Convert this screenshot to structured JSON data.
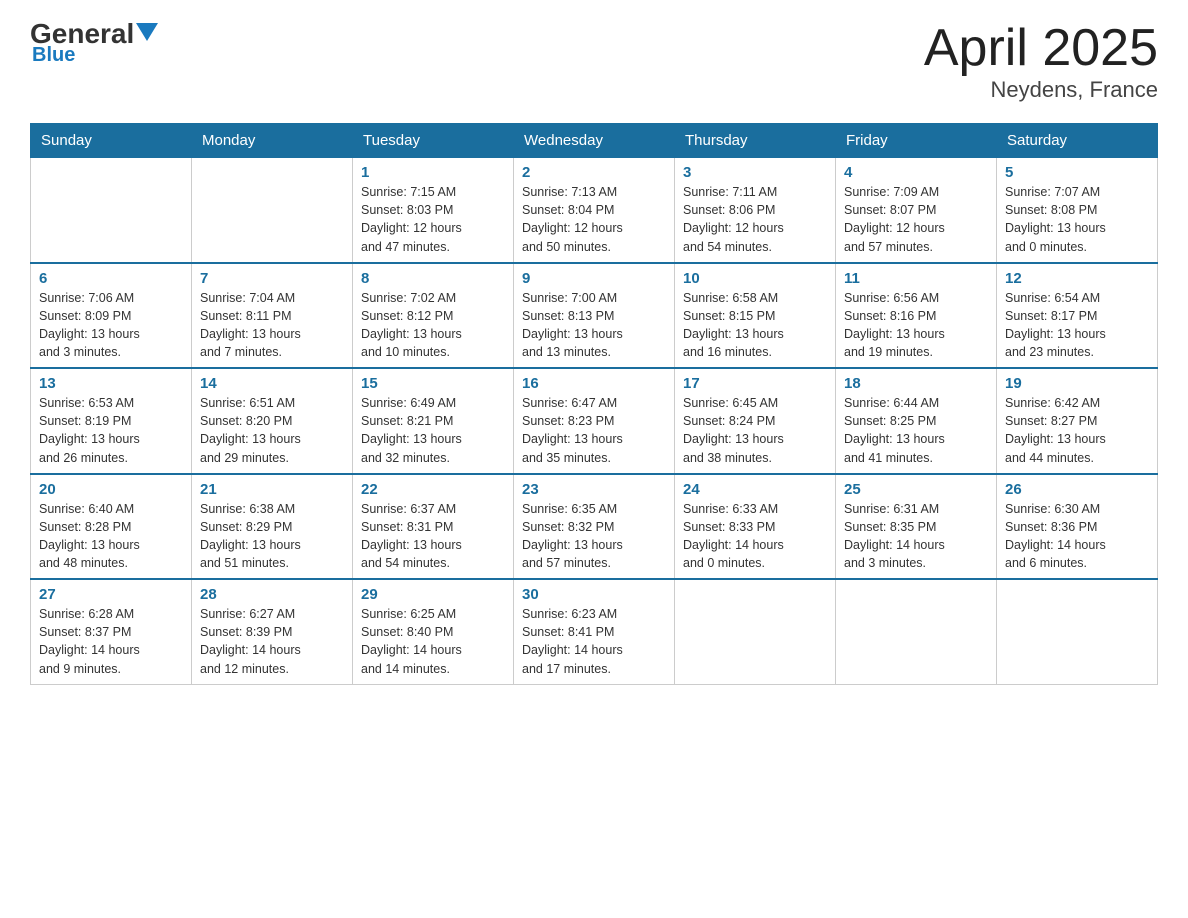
{
  "header": {
    "logo_general": "General",
    "logo_blue": "Blue",
    "title": "April 2025",
    "subtitle": "Neydens, France"
  },
  "days_of_week": [
    "Sunday",
    "Monday",
    "Tuesday",
    "Wednesday",
    "Thursday",
    "Friday",
    "Saturday"
  ],
  "weeks": [
    [
      {
        "day": "",
        "info": ""
      },
      {
        "day": "",
        "info": ""
      },
      {
        "day": "1",
        "info": "Sunrise: 7:15 AM\nSunset: 8:03 PM\nDaylight: 12 hours\nand 47 minutes."
      },
      {
        "day": "2",
        "info": "Sunrise: 7:13 AM\nSunset: 8:04 PM\nDaylight: 12 hours\nand 50 minutes."
      },
      {
        "day": "3",
        "info": "Sunrise: 7:11 AM\nSunset: 8:06 PM\nDaylight: 12 hours\nand 54 minutes."
      },
      {
        "day": "4",
        "info": "Sunrise: 7:09 AM\nSunset: 8:07 PM\nDaylight: 12 hours\nand 57 minutes."
      },
      {
        "day": "5",
        "info": "Sunrise: 7:07 AM\nSunset: 8:08 PM\nDaylight: 13 hours\nand 0 minutes."
      }
    ],
    [
      {
        "day": "6",
        "info": "Sunrise: 7:06 AM\nSunset: 8:09 PM\nDaylight: 13 hours\nand 3 minutes."
      },
      {
        "day": "7",
        "info": "Sunrise: 7:04 AM\nSunset: 8:11 PM\nDaylight: 13 hours\nand 7 minutes."
      },
      {
        "day": "8",
        "info": "Sunrise: 7:02 AM\nSunset: 8:12 PM\nDaylight: 13 hours\nand 10 minutes."
      },
      {
        "day": "9",
        "info": "Sunrise: 7:00 AM\nSunset: 8:13 PM\nDaylight: 13 hours\nand 13 minutes."
      },
      {
        "day": "10",
        "info": "Sunrise: 6:58 AM\nSunset: 8:15 PM\nDaylight: 13 hours\nand 16 minutes."
      },
      {
        "day": "11",
        "info": "Sunrise: 6:56 AM\nSunset: 8:16 PM\nDaylight: 13 hours\nand 19 minutes."
      },
      {
        "day": "12",
        "info": "Sunrise: 6:54 AM\nSunset: 8:17 PM\nDaylight: 13 hours\nand 23 minutes."
      }
    ],
    [
      {
        "day": "13",
        "info": "Sunrise: 6:53 AM\nSunset: 8:19 PM\nDaylight: 13 hours\nand 26 minutes."
      },
      {
        "day": "14",
        "info": "Sunrise: 6:51 AM\nSunset: 8:20 PM\nDaylight: 13 hours\nand 29 minutes."
      },
      {
        "day": "15",
        "info": "Sunrise: 6:49 AM\nSunset: 8:21 PM\nDaylight: 13 hours\nand 32 minutes."
      },
      {
        "day": "16",
        "info": "Sunrise: 6:47 AM\nSunset: 8:23 PM\nDaylight: 13 hours\nand 35 minutes."
      },
      {
        "day": "17",
        "info": "Sunrise: 6:45 AM\nSunset: 8:24 PM\nDaylight: 13 hours\nand 38 minutes."
      },
      {
        "day": "18",
        "info": "Sunrise: 6:44 AM\nSunset: 8:25 PM\nDaylight: 13 hours\nand 41 minutes."
      },
      {
        "day": "19",
        "info": "Sunrise: 6:42 AM\nSunset: 8:27 PM\nDaylight: 13 hours\nand 44 minutes."
      }
    ],
    [
      {
        "day": "20",
        "info": "Sunrise: 6:40 AM\nSunset: 8:28 PM\nDaylight: 13 hours\nand 48 minutes."
      },
      {
        "day": "21",
        "info": "Sunrise: 6:38 AM\nSunset: 8:29 PM\nDaylight: 13 hours\nand 51 minutes."
      },
      {
        "day": "22",
        "info": "Sunrise: 6:37 AM\nSunset: 8:31 PM\nDaylight: 13 hours\nand 54 minutes."
      },
      {
        "day": "23",
        "info": "Sunrise: 6:35 AM\nSunset: 8:32 PM\nDaylight: 13 hours\nand 57 minutes."
      },
      {
        "day": "24",
        "info": "Sunrise: 6:33 AM\nSunset: 8:33 PM\nDaylight: 14 hours\nand 0 minutes."
      },
      {
        "day": "25",
        "info": "Sunrise: 6:31 AM\nSunset: 8:35 PM\nDaylight: 14 hours\nand 3 minutes."
      },
      {
        "day": "26",
        "info": "Sunrise: 6:30 AM\nSunset: 8:36 PM\nDaylight: 14 hours\nand 6 minutes."
      }
    ],
    [
      {
        "day": "27",
        "info": "Sunrise: 6:28 AM\nSunset: 8:37 PM\nDaylight: 14 hours\nand 9 minutes."
      },
      {
        "day": "28",
        "info": "Sunrise: 6:27 AM\nSunset: 8:39 PM\nDaylight: 14 hours\nand 12 minutes."
      },
      {
        "day": "29",
        "info": "Sunrise: 6:25 AM\nSunset: 8:40 PM\nDaylight: 14 hours\nand 14 minutes."
      },
      {
        "day": "30",
        "info": "Sunrise: 6:23 AM\nSunset: 8:41 PM\nDaylight: 14 hours\nand 17 minutes."
      },
      {
        "day": "",
        "info": ""
      },
      {
        "day": "",
        "info": ""
      },
      {
        "day": "",
        "info": ""
      }
    ]
  ]
}
